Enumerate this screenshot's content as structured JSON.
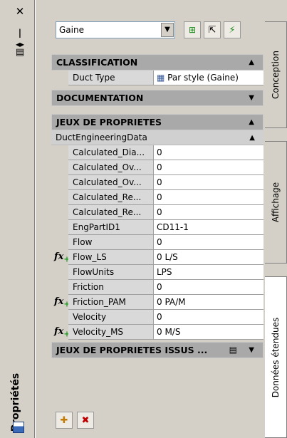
{
  "palette": {
    "title": "Propriétés"
  },
  "toolbar": {
    "combo_value": "Gaine"
  },
  "sections": {
    "classification": {
      "title": "CLASSIFICATION",
      "rows": [
        {
          "name": "Duct Type",
          "value": "Par style (Gaine)"
        }
      ]
    },
    "documentation": {
      "title": "DOCUMENTATION"
    },
    "jeux": {
      "title": "JEUX DE PROPRIETES",
      "subgroup": "DuctEngineeringData",
      "rows": [
        {
          "name": "Calculated_Dia...",
          "value": "0",
          "formula": false
        },
        {
          "name": "Calculated_Ov...",
          "value": "0",
          "formula": false
        },
        {
          "name": "Calculated_Ov...",
          "value": "0",
          "formula": false
        },
        {
          "name": "Calculated_Re...",
          "value": "0",
          "formula": false
        },
        {
          "name": "Calculated_Re...",
          "value": "0",
          "formula": false
        },
        {
          "name": "EngPartID1",
          "value": "CD11-1",
          "formula": false
        },
        {
          "name": "Flow",
          "value": "0",
          "formula": false
        },
        {
          "name": "Flow_LS",
          "value": "0 L/S",
          "formula": true
        },
        {
          "name": "FlowUnits",
          "value": "LPS",
          "formula": false
        },
        {
          "name": "Friction",
          "value": "0",
          "formula": false
        },
        {
          "name": "Friction_PAM",
          "value": "0 PA/M",
          "formula": true
        },
        {
          "name": "Velocity",
          "value": "0",
          "formula": false
        },
        {
          "name": "Velocity_MS",
          "value": "0 M/S",
          "formula": true
        }
      ]
    },
    "jeux_issus": {
      "title": "JEUX DE PROPRIETES ISSUS ..."
    }
  },
  "tabs": [
    {
      "label": "Conception"
    },
    {
      "label": "Affichage"
    },
    {
      "label": "Données étendues"
    }
  ],
  "icons": {
    "fx": "fx",
    "fx_sub": "+"
  }
}
